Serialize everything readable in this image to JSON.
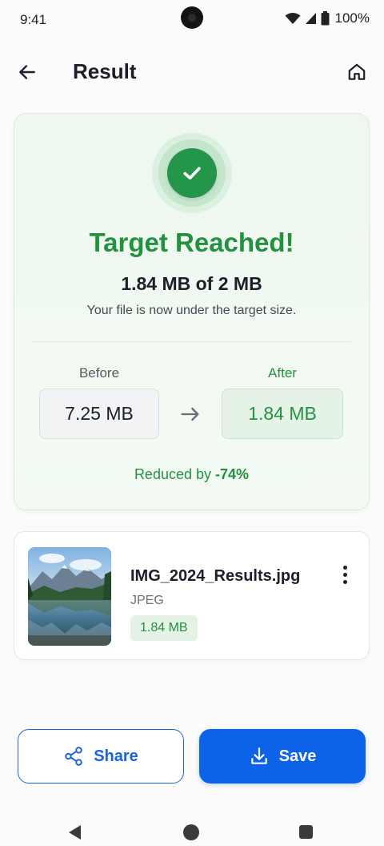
{
  "status_bar": {
    "time": "9:41",
    "battery_pct": "100%",
    "icons": [
      "wifi-icon",
      "signal-icon",
      "battery-icon"
    ]
  },
  "app_bar": {
    "title": "Result",
    "back_icon": "arrow-left-icon",
    "home_icon": "home-icon"
  },
  "result": {
    "icon": "check-icon",
    "headline": "Target Reached!",
    "size_line": "1.84 MB of 2 MB",
    "subtext": "Your file is now under the target size.",
    "before_label": "Before",
    "before_value": "7.25 MB",
    "after_label": "After",
    "after_value": "1.84 MB",
    "reduced_prefix": "Reduced by",
    "reduced_pct": "-74%"
  },
  "file": {
    "name": "IMG_2024_Results.jpg",
    "type": "JPEG",
    "size": "1.84 MB",
    "thumbnail": "mountain-lake-landscape"
  },
  "actions": {
    "share_label": "Share",
    "save_label": "Save"
  },
  "colors": {
    "success": "#23913f",
    "primary": "#0d63e8"
  }
}
